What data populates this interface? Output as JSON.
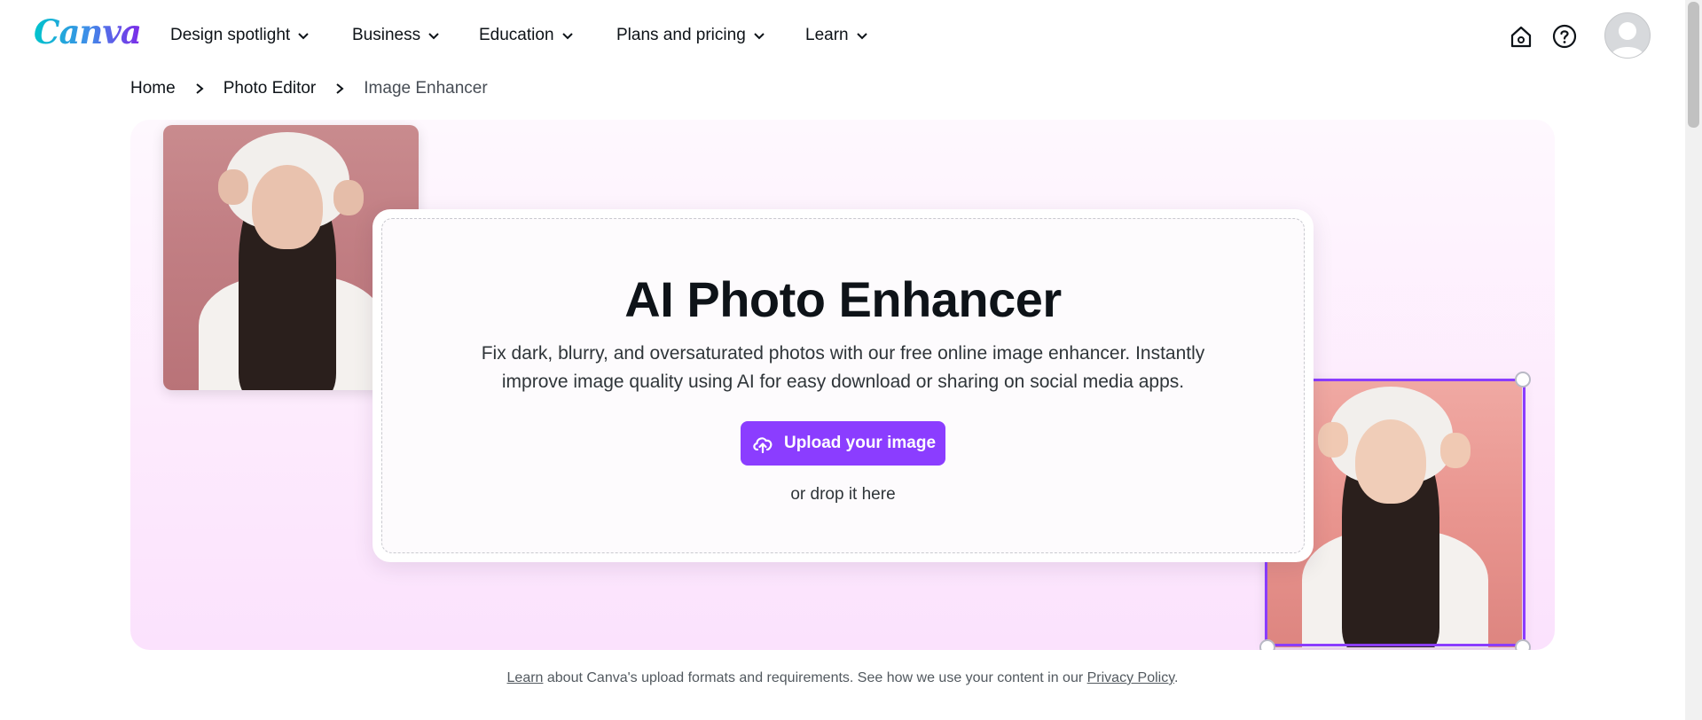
{
  "nav": {
    "logo": "Canva",
    "items": [
      {
        "label": "Design spotlight"
      },
      {
        "label": "Business"
      },
      {
        "label": "Education"
      },
      {
        "label": "Plans and pricing"
      },
      {
        "label": "Learn"
      }
    ]
  },
  "breadcrumb": {
    "home": "Home",
    "photo_editor": "Photo Editor",
    "current": "Image Enhancer"
  },
  "hero": {
    "title": "AI Photo Enhancer",
    "description": "Fix dark, blurry, and oversaturated photos with our free online image enhancer. Instantly improve image quality using AI for easy download or sharing on social media apps.",
    "upload_label": "Upload your image",
    "drop_label": "or drop it here"
  },
  "footer": {
    "learn_link": "Learn",
    "text_middle": " about Canva's upload formats and requirements. See how we use your content in our ",
    "privacy_link": "Privacy Policy",
    "text_end": "."
  },
  "colors": {
    "accent": "#8b3dff",
    "hero_bg": "#fdeafd",
    "text": "#0e1318"
  }
}
